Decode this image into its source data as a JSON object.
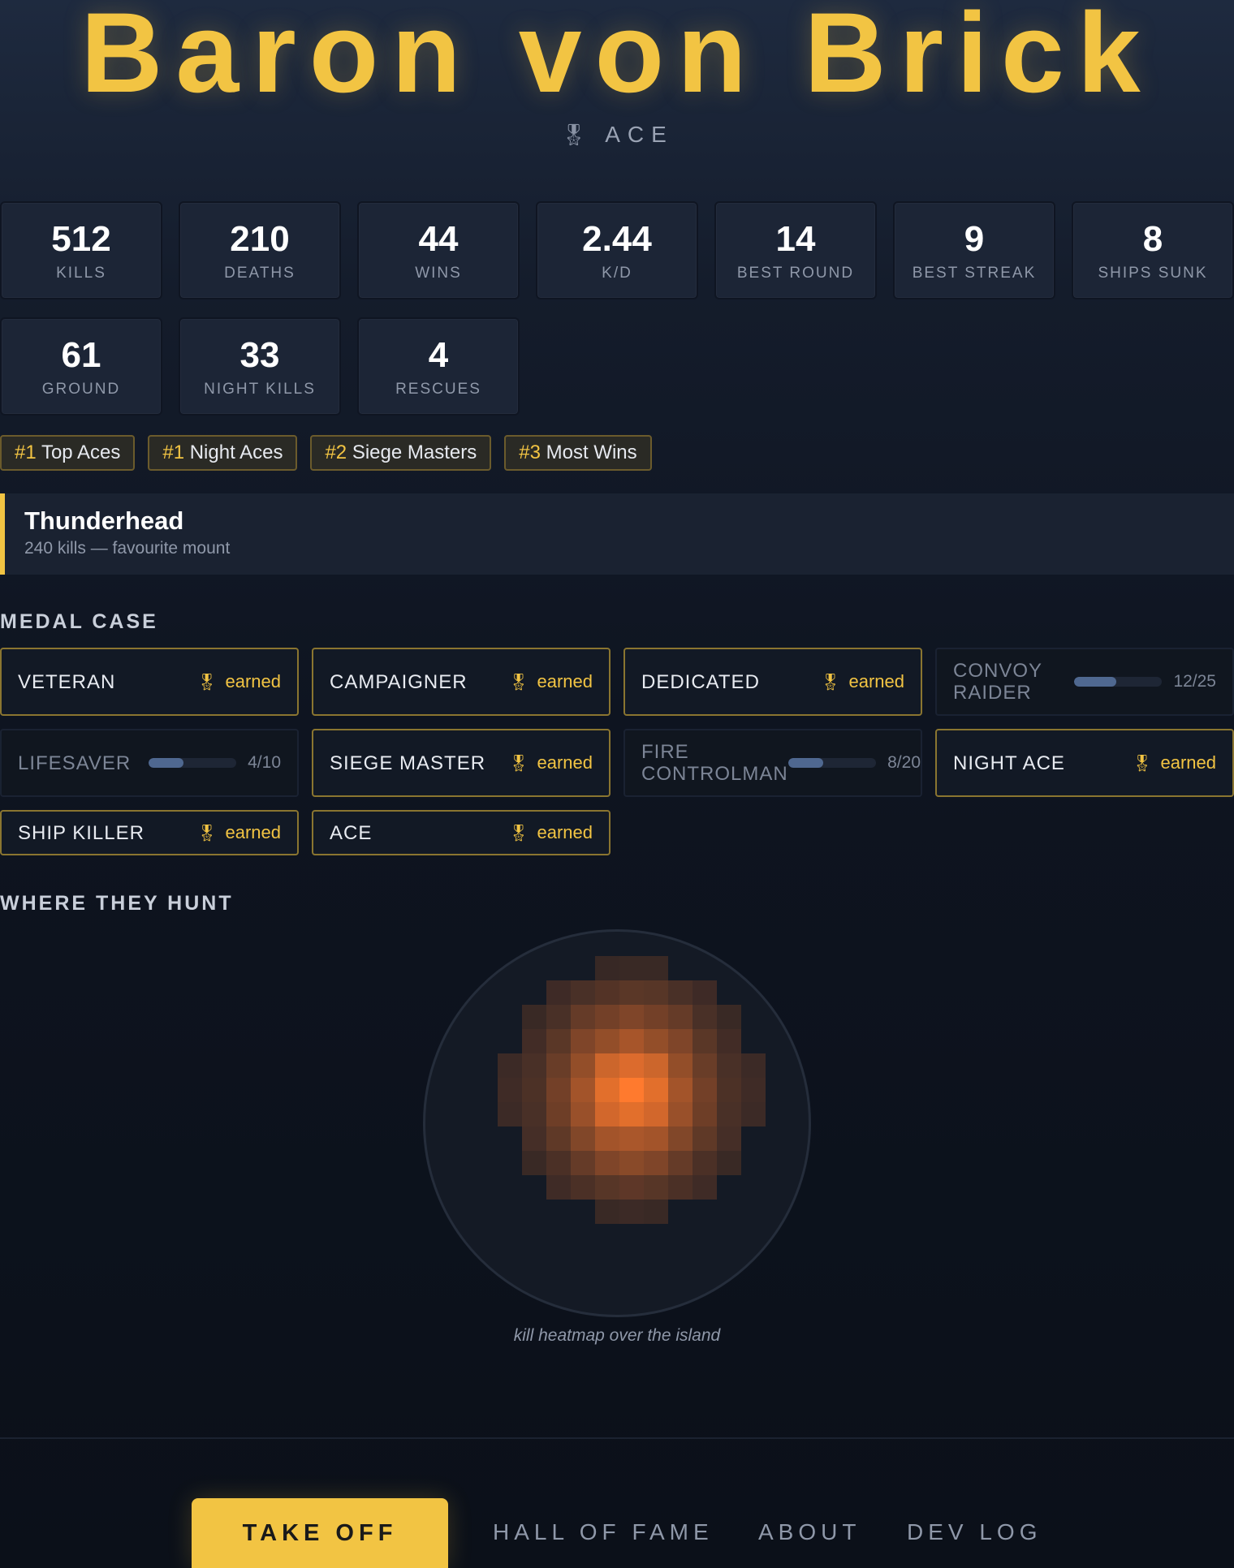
{
  "profile": {
    "name": "Baron von Brick",
    "rank_icon": "medal-icon",
    "rank": "ACE"
  },
  "stats": [
    {
      "value": "512",
      "label": "KILLS"
    },
    {
      "value": "210",
      "label": "DEATHS"
    },
    {
      "value": "44",
      "label": "WINS"
    },
    {
      "value": "2.44",
      "label": "K/D"
    },
    {
      "value": "14",
      "label": "BEST ROUND"
    },
    {
      "value": "9",
      "label": "BEST STREAK"
    },
    {
      "value": "8",
      "label": "SHIPS SUNK"
    },
    {
      "value": "61",
      "label": "GROUND"
    },
    {
      "value": "33",
      "label": "NIGHT KILLS"
    },
    {
      "value": "4",
      "label": "RESCUES"
    }
  ],
  "leaderboards": [
    {
      "pos": "#1",
      "label": "Top Aces"
    },
    {
      "pos": "#1",
      "label": "Night Aces"
    },
    {
      "pos": "#2",
      "label": "Siege Masters"
    },
    {
      "pos": "#3",
      "label": "Most Wins"
    }
  ],
  "mount": {
    "name": "Thunderhead",
    "detail": "240 kills — favourite mount"
  },
  "medal_case": {
    "title": "MEDAL CASE",
    "earned_label": "earned",
    "medals": [
      {
        "name": "VETERAN",
        "earned": true
      },
      {
        "name": "CAMPAIGNER",
        "earned": true
      },
      {
        "name": "DEDICATED",
        "earned": true
      },
      {
        "name": "CONVOY RAIDER",
        "earned": false,
        "progress": "12/25",
        "fraction": 0.48
      },
      {
        "name": "LIFESAVER",
        "earned": false,
        "progress": "4/10",
        "fraction": 0.4
      },
      {
        "name": "SIEGE MASTER",
        "earned": true
      },
      {
        "name": "FIRE CONTROLMAN",
        "earned": false,
        "progress": "8/20",
        "fraction": 0.4
      },
      {
        "name": "NIGHT ACE",
        "earned": true
      },
      {
        "name": "SHIP KILLER",
        "earned": true
      },
      {
        "name": "ACE",
        "earned": true
      }
    ]
  },
  "hunt": {
    "title": "WHERE THEY HUNT",
    "caption": "kill heatmap over the island",
    "heatmap": [
      [
        0,
        0,
        0,
        0,
        0,
        0,
        0,
        0,
        0,
        0,
        0,
        0,
        0,
        0,
        0,
        0
      ],
      [
        0,
        0,
        0,
        0,
        0,
        0,
        0.1,
        0.12,
        0.12,
        0,
        0,
        0,
        0,
        0,
        0,
        0
      ],
      [
        0,
        0,
        0,
        0,
        0.15,
        0.22,
        0.28,
        0.32,
        0.3,
        0.22,
        0.15,
        0,
        0,
        0,
        0,
        0
      ],
      [
        0,
        0,
        0,
        0.12,
        0.22,
        0.38,
        0.45,
        0.5,
        0.45,
        0.38,
        0.22,
        0.12,
        0,
        0,
        0,
        0
      ],
      [
        0,
        0,
        0,
        0.18,
        0.32,
        0.5,
        0.6,
        0.68,
        0.6,
        0.5,
        0.32,
        0.18,
        0,
        0,
        0,
        0
      ],
      [
        0,
        0,
        0.14,
        0.22,
        0.4,
        0.6,
        0.82,
        0.88,
        0.82,
        0.6,
        0.4,
        0.22,
        0.14,
        0,
        0,
        0
      ],
      [
        0,
        0,
        0.16,
        0.25,
        0.45,
        0.66,
        0.9,
        1.0,
        0.9,
        0.66,
        0.45,
        0.25,
        0.16,
        0,
        0,
        0
      ],
      [
        0,
        0,
        0.14,
        0.22,
        0.42,
        0.62,
        0.85,
        0.9,
        0.85,
        0.62,
        0.42,
        0.22,
        0.14,
        0,
        0,
        0
      ],
      [
        0,
        0,
        0,
        0.2,
        0.35,
        0.52,
        0.66,
        0.7,
        0.66,
        0.52,
        0.35,
        0.2,
        0,
        0,
        0,
        0
      ],
      [
        0,
        0,
        0,
        0.12,
        0.24,
        0.38,
        0.5,
        0.55,
        0.5,
        0.38,
        0.24,
        0.12,
        0,
        0,
        0,
        0
      ],
      [
        0,
        0,
        0,
        0,
        0.16,
        0.24,
        0.3,
        0.34,
        0.3,
        0.24,
        0.16,
        0,
        0,
        0,
        0,
        0
      ],
      [
        0,
        0,
        0,
        0,
        0,
        0,
        0.12,
        0.14,
        0.12,
        0,
        0,
        0,
        0,
        0,
        0,
        0
      ],
      [
        0,
        0,
        0,
        0,
        0,
        0,
        0,
        0,
        0,
        0,
        0,
        0,
        0,
        0,
        0,
        0
      ]
    ]
  },
  "nav": {
    "primary": "TAKE OFF",
    "links": [
      "HALL OF FAME",
      "ABOUT",
      "DEV LOG"
    ]
  },
  "colors": {
    "accent": "#f2c443",
    "heat_low": "#3a2a26",
    "heat_high": "#ff7a2e"
  }
}
